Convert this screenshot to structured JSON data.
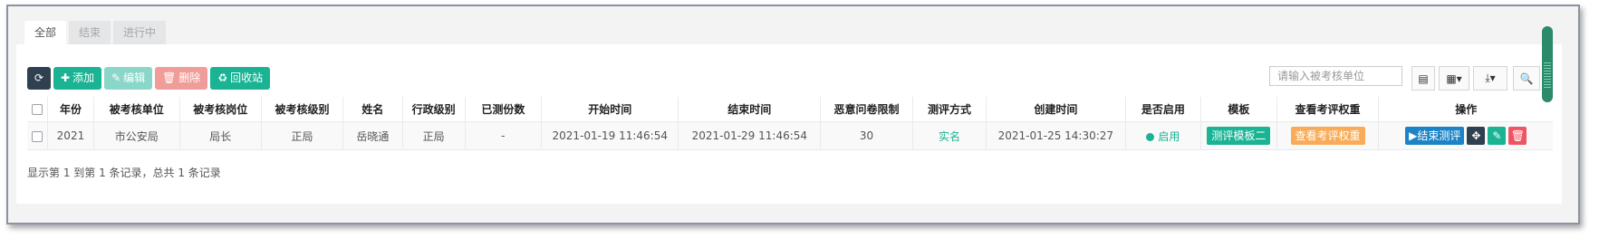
{
  "tabs": [
    "全部",
    "结束",
    "进行中"
  ],
  "toolbar": {
    "refresh_icon": "refresh-icon",
    "add": "添加",
    "edit": "编辑",
    "delete": "删除",
    "recycle": "回收站"
  },
  "search": {
    "placeholder": "请输入被考核单位"
  },
  "table": {
    "headers": [
      "年份",
      "被考核单位",
      "被考核岗位",
      "被考核级别",
      "姓名",
      "行政级别",
      "已测份数",
      "开始时间",
      "结束时间",
      "恶意问卷限制",
      "测评方式",
      "创建时间",
      "是否启用",
      "模板",
      "查看考评权重",
      "操作"
    ],
    "rows": [
      {
        "year": "2021",
        "unit": "市公安局",
        "post": "局长",
        "level": "正局",
        "name": "岳晓通",
        "admin_level": "正局",
        "count": "-",
        "start": "2021-01-19 11:46:54",
        "end": "2021-01-29 11:46:54",
        "limit": "30",
        "method": "实名",
        "created": "2021-01-25 14:30:27",
        "enabled": "启用",
        "template": "测评模板二",
        "weight": "查看考评权重",
        "end_eval": "结束测评"
      }
    ]
  },
  "footer": "显示第 1 到第 1 条记录，总共 1 条记录",
  "colors": {
    "green": "#1ab394",
    "dark": "#2f4050",
    "orange": "#f8ac59",
    "red": "#ed5565",
    "blue": "#1c84c6"
  }
}
